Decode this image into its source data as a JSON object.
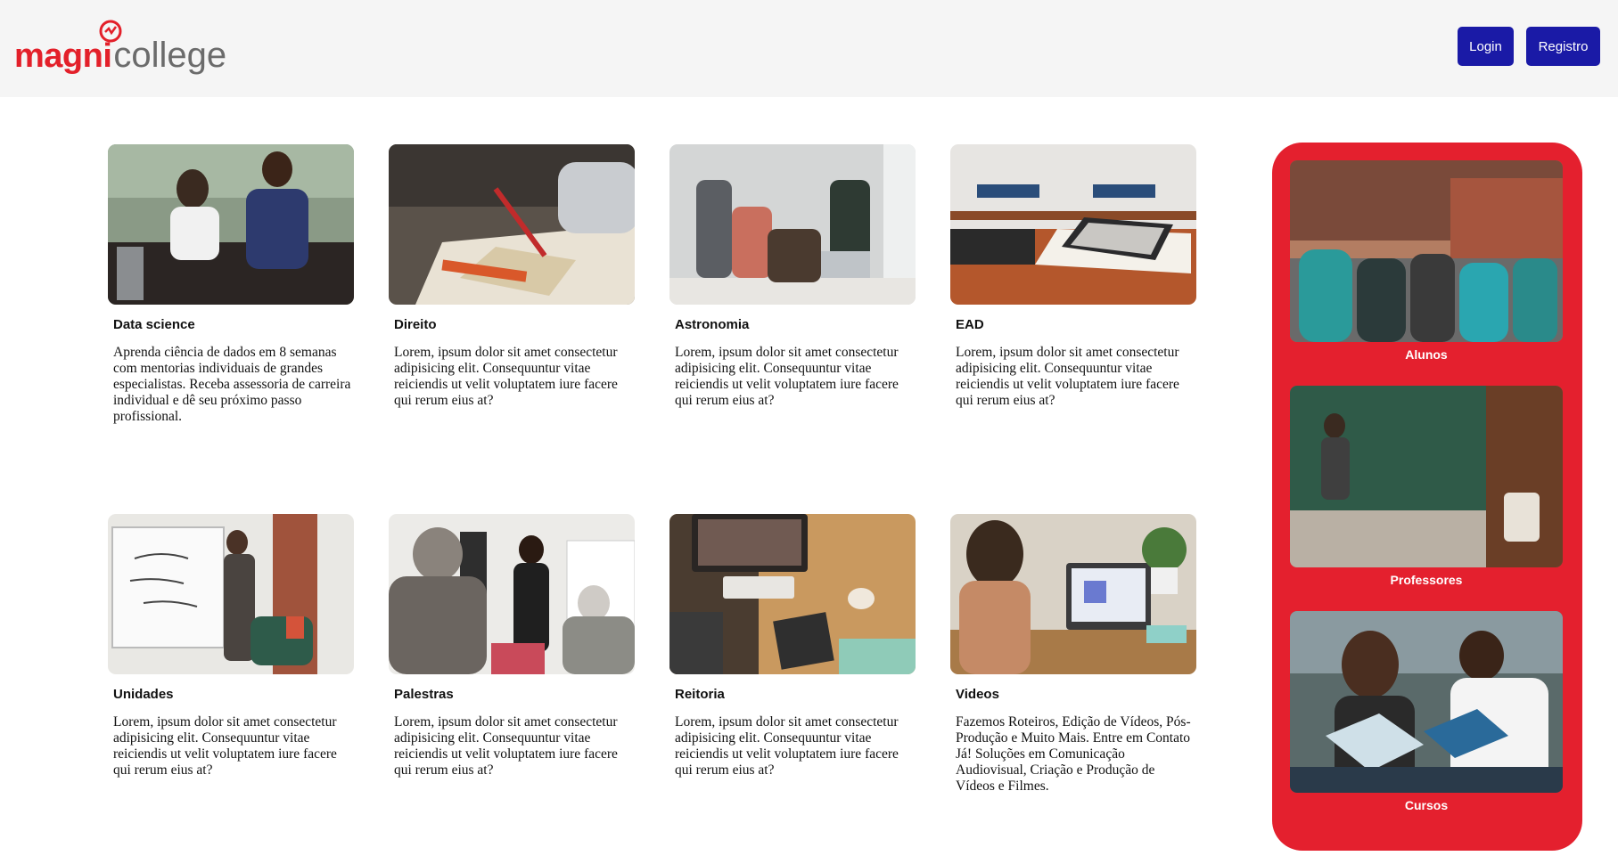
{
  "header": {
    "logo_brand": "magni",
    "logo_college": "college",
    "login_label": "Login",
    "register_label": "Registro"
  },
  "cards": [
    {
      "title": "Data science",
      "text": "Aprenda ciência de dados em 8 semanas com mentorias individuais de grandes especialistas. Receba assessoria de carreira individual e dê seu próximo passo profissional.",
      "image": "office-meeting-photo"
    },
    {
      "title": "Direito",
      "text": "Lorem, ipsum dolor sit amet consectetur adipisicing elit. Consequuntur vitae reiciendis ut velit voluptatem iure facere qui rerum eius at?",
      "image": "writing-notebook-photo"
    },
    {
      "title": "Astronomia",
      "text": "Lorem, ipsum dolor sit amet consectetur adipisicing elit. Consequuntur vitae reiciendis ut velit voluptatem iure facere qui rerum eius at?",
      "image": "team-laptop-photo"
    },
    {
      "title": "EAD",
      "text": "Lorem, ipsum dolor sit amet consectetur adipisicing elit. Consequuntur vitae reiciendis ut velit voluptatem iure facere qui rerum eius at?",
      "image": "books-tablet-photo"
    },
    {
      "title": "Unidades",
      "text": "Lorem, ipsum dolor sit amet consectetur adipisicing elit. Consequuntur vitae reiciendis ut velit voluptatem iure facere qui rerum eius at?",
      "image": "whiteboard-presentation-photo"
    },
    {
      "title": "Palestras",
      "text": "Lorem, ipsum dolor sit amet consectetur adipisicing elit. Consequuntur vitae reiciendis ut velit voluptatem iure facere qui rerum eius at?",
      "image": "lecture-audience-photo"
    },
    {
      "title": "Reitoria",
      "text": "Lorem, ipsum dolor sit amet consectetur adipisicing elit. Consequuntur vitae reiciendis ut velit voluptatem iure facere qui rerum eius at?",
      "image": "desk-overhead-photo"
    },
    {
      "title": "Videos",
      "text": "Fazemos Roteiros, Edição de Vídeos, Pós-Produção e Muito Mais. Entre em Contato Já! Soluções em Comunicação Audiovisual, Criação e Produção de Vídeos e Filmes.",
      "image": "laptop-study-photo"
    }
  ],
  "sidebar": {
    "color": "#e4202e",
    "items": [
      {
        "label": "Alunos",
        "image": "students-backpacks-photo"
      },
      {
        "label": "Professores",
        "image": "teacher-chalkboard-photo"
      },
      {
        "label": "Cursos",
        "image": "students-reading-photo"
      }
    ]
  },
  "colors": {
    "button": "#1a1aa6",
    "header_bg": "#f5f5f5",
    "brand_red": "#e3202a"
  }
}
